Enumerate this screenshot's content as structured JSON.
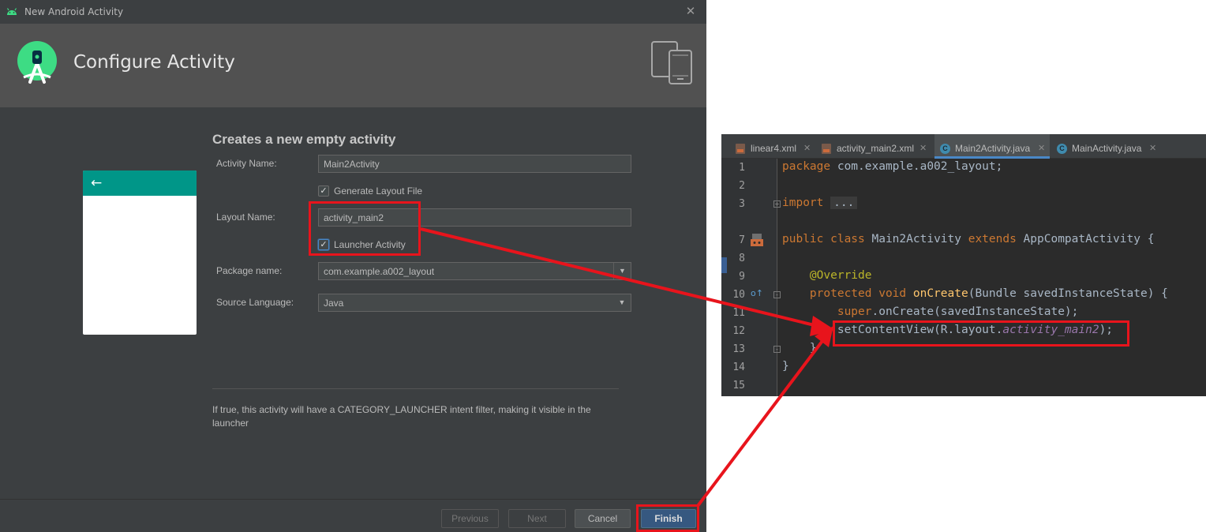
{
  "dialog": {
    "window_title": "New Android Activity",
    "header_title": "Configure Activity",
    "form_title": "Creates a new empty activity",
    "fields": {
      "activity_name_label": "Activity Name:",
      "activity_name_value": "Main2Activity",
      "generate_layout_label": "Generate Layout File",
      "layout_name_label": "Layout Name:",
      "layout_name_value": "activity_main2",
      "launcher_label": "Launcher Activity",
      "package_name_label": "Package name:",
      "package_name_value": "com.example.a002_layout",
      "source_language_label": "Source Language:",
      "source_language_value": "Java"
    },
    "help_text": "If true, this activity will have a CATEGORY_LAUNCHER intent filter, making it visible in the launcher",
    "buttons": {
      "previous": "Previous",
      "next": "Next",
      "cancel": "Cancel",
      "finish": "Finish"
    },
    "colors": {
      "preview_toolbar": "#009688",
      "highlight": "#e8141c",
      "primary_button": "#365880"
    }
  },
  "editor": {
    "tabs": [
      {
        "label": "linear4.xml",
        "icon": "xml-file-icon"
      },
      {
        "label": "activity_main2.xml",
        "icon": "xml-file-icon"
      },
      {
        "label": "Main2Activity.java",
        "icon": "java-class-icon",
        "active": true
      },
      {
        "label": "MainActivity.java",
        "icon": "java-class-icon"
      }
    ],
    "line_numbers": [
      "1",
      "2",
      "3",
      "7",
      "8",
      "9",
      "10",
      "11",
      "12",
      "13",
      "14",
      "15"
    ],
    "code": {
      "l1_kw": "package",
      "l1_rest": " com.example.a002_layout;",
      "l3_kw": "import",
      "l3_fold": "...",
      "l7_kw1": "public class",
      "l7_name": " Main2Activity ",
      "l7_kw2": "extends",
      "l7_rest": " AppCompatActivity {",
      "l9_ann": "@Override",
      "l10_kw": "protected void",
      "l10_fn": " onCreate",
      "l10_rest": "(Bundle savedInstanceState) {",
      "l11_kw": "super",
      "l11_rest": ".onCreate(savedInstanceState);",
      "l12_a": "setContentView(R.layout.",
      "l12_it": "activity_main2",
      "l12_b": ");",
      "l13": "}",
      "l14": "}"
    }
  }
}
